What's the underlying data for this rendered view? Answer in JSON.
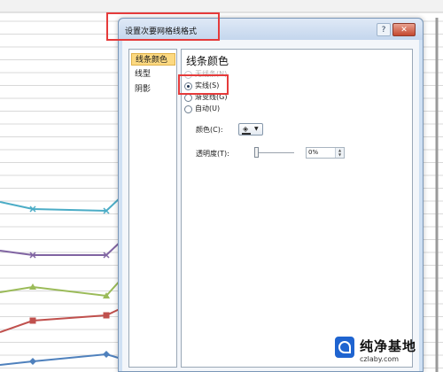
{
  "dialog": {
    "title": "设置次要网格线格式",
    "help_label": "?",
    "close_label": "✕"
  },
  "nav": {
    "items": [
      {
        "label": "线条颜色",
        "selected": true
      },
      {
        "label": "线型",
        "selected": false
      },
      {
        "label": "阴影",
        "selected": false
      }
    ]
  },
  "line_color": {
    "section_title": "线条颜色",
    "options": [
      {
        "label": "无线条(N)",
        "checked": false,
        "disabled": true
      },
      {
        "label": "实线(S)",
        "checked": true,
        "disabled": false
      },
      {
        "label": "渐变线(G)",
        "checked": false,
        "disabled": false
      },
      {
        "label": "自动(U)",
        "checked": false,
        "disabled": false
      }
    ],
    "color_label": "颜色(C):",
    "color_icon": "paint-bucket-icon",
    "line_color_value": "#2f2f2f",
    "transparency_label": "透明度(T):",
    "transparency_value": "0%",
    "transparency_fraction": 0
  },
  "background_chart": {
    "series": [
      {
        "color": "#4bacc6",
        "marker": "x"
      },
      {
        "color": "#8064a2",
        "marker": "x"
      },
      {
        "color": "#9bbb59",
        "marker": "triangle"
      },
      {
        "color": "#c0504d",
        "marker": "square"
      },
      {
        "color": "#4f81bd",
        "marker": "diamond"
      }
    ]
  },
  "watermark": {
    "brand": "纯净基地",
    "url": "czlaby.com"
  },
  "accent": {
    "highlight_box": "#e53b3b",
    "selected_nav_bg": "#fcd981"
  }
}
